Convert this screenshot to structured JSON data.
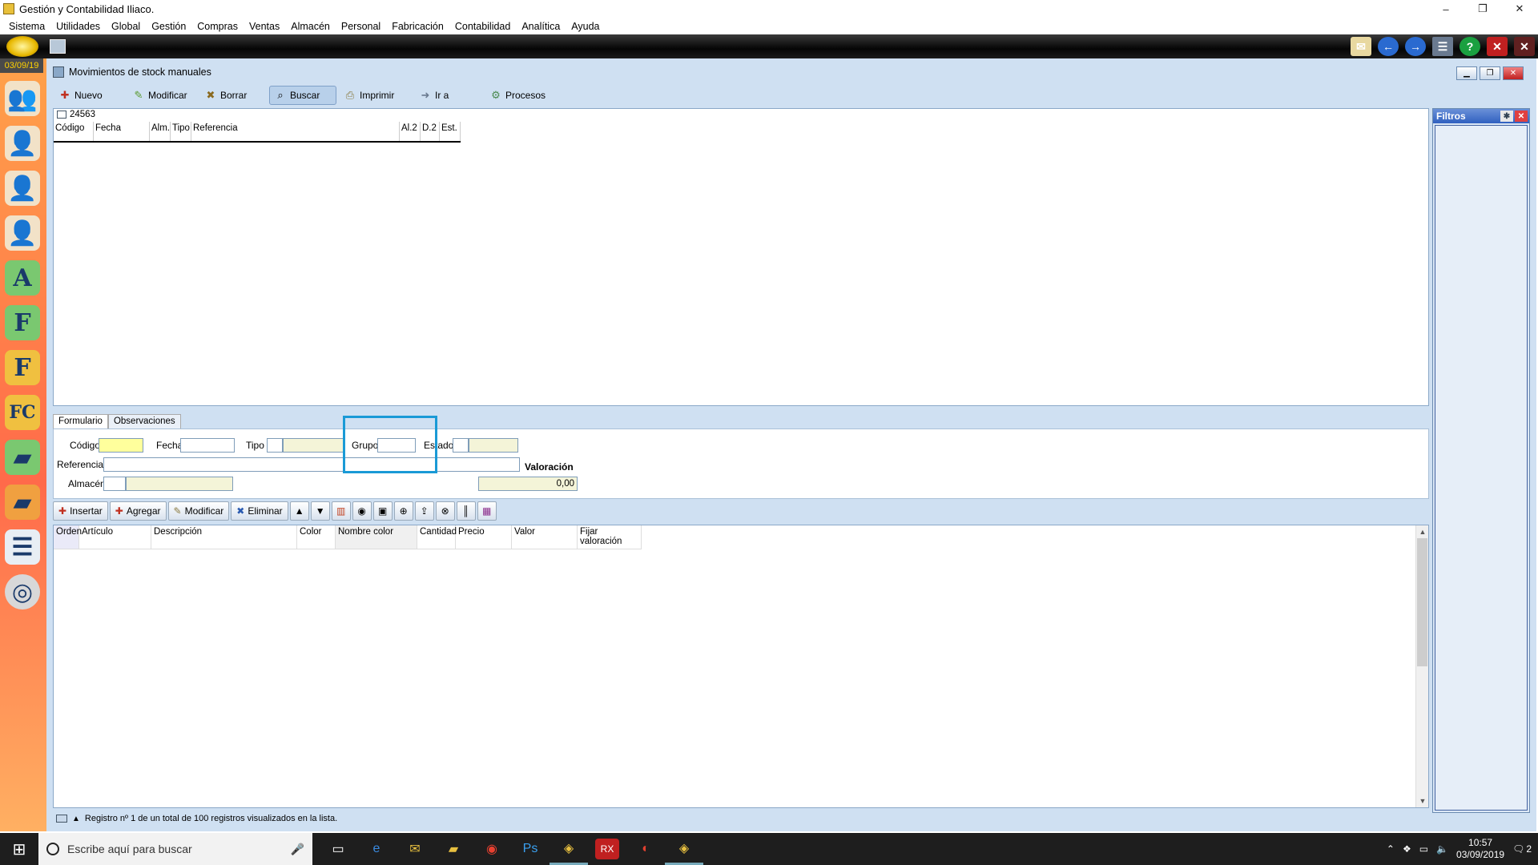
{
  "window": {
    "title": "Gestión y Contabilidad Iliaco.",
    "min": "–",
    "max": "❐",
    "close": "✕"
  },
  "menu": [
    "Sistema",
    "Utilidades",
    "Global",
    "Gestión",
    "Compras",
    "Ventas",
    "Almacén",
    "Personal",
    "Fabricación",
    "Contabilidad",
    "Analítica",
    "Ayuda"
  ],
  "sidebar": {
    "date": "03/09/19"
  },
  "doc": {
    "title": "Movimientos de stock manuales"
  },
  "toolbar": {
    "nuevo": "Nuevo",
    "modificar": "Modificar",
    "borrar": "Borrar",
    "buscar": "Buscar",
    "imprimir": "Imprimir",
    "ir_a": "Ir a",
    "procesos": "Procesos"
  },
  "list": {
    "count": "24563",
    "columns": [
      "Código",
      "Fecha",
      "Alm.",
      "Tipo",
      "Referencia",
      "Al.2",
      "D.2",
      "Est."
    ]
  },
  "filters": {
    "title": "Filtros"
  },
  "form": {
    "tabs": [
      "Formulario",
      "Observaciones"
    ],
    "labels": {
      "codigo": "Código",
      "fecha": "Fecha",
      "tipo": "Tipo",
      "grupo": "Grupo",
      "estado": "Estado",
      "referencia": "Referencia",
      "almacen": "Almacén",
      "valoracion": "Valoración"
    },
    "valoracion_value": "0,00"
  },
  "toolbar2": {
    "insertar": "Insertar",
    "agregar": "Agregar",
    "modificar": "Modificar",
    "eliminar": "Eliminar"
  },
  "detail": {
    "columns": [
      "Orden",
      "Artículo",
      "Descripción",
      "Color",
      "Nombre color",
      "Cantidad",
      "Precio",
      "Valor",
      "Fijar valoración"
    ]
  },
  "status": {
    "text": "Registro nº 1 de un total de 100 registros visualizados en la lista."
  },
  "taskbar": {
    "search_placeholder": "Escribe aquí para buscar",
    "time": "10:57",
    "date": "03/09/2019",
    "notifications": "2"
  }
}
